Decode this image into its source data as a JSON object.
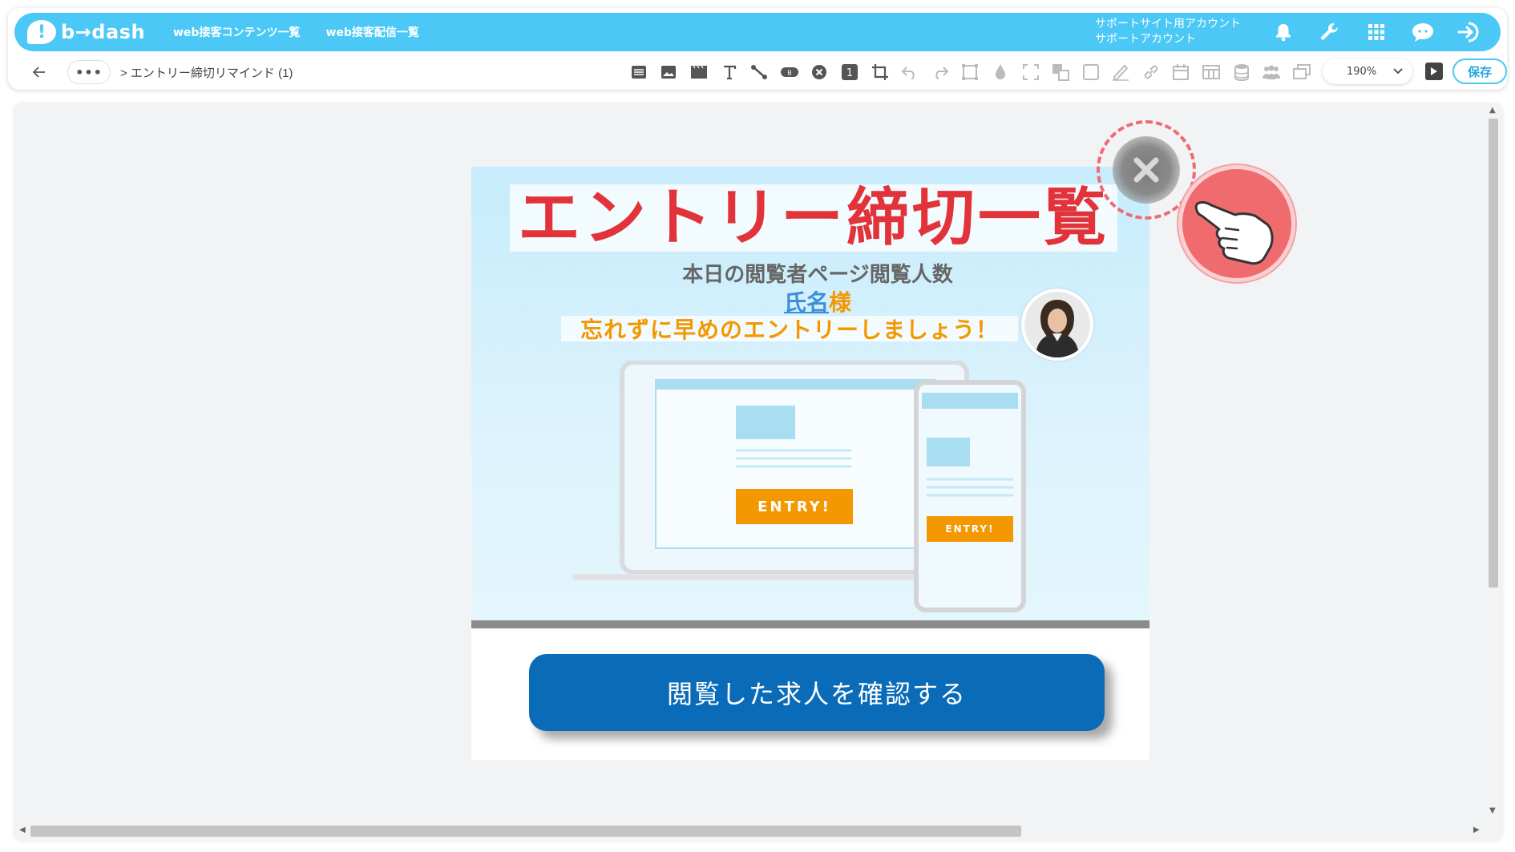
{
  "header": {
    "logo_text": "b→dash",
    "nav": [
      "web接客コンテンツ一覧",
      "web接客配信一覧"
    ],
    "account_line1": "サポートサイト用アカウント",
    "account_line2": "サポートアカウント",
    "icons": [
      "bell-icon",
      "wrench-icon",
      "grid-icon",
      "chat-bot-icon",
      "logout-icon"
    ],
    "bg_color": "#4bc8f5"
  },
  "toolbar": {
    "more_label": "•••",
    "breadcrumb": "> エントリー締切リマインド (1)",
    "zoom_value": "190%",
    "save_label": "保存",
    "tool_icons": [
      "list-icon",
      "image-icon",
      "video-icon",
      "text-icon",
      "connector-icon",
      "badge-icon",
      "close-element-icon",
      "number-icon",
      "crop-icon",
      "undo-icon",
      "redo-icon",
      "frame-icon",
      "drop-icon",
      "expand-icon",
      "layers-icon",
      "square-icon",
      "pen-icon",
      "link-icon",
      "calendar-icon",
      "table-icon",
      "database-icon",
      "users-icon",
      "copy-icon"
    ]
  },
  "banner": {
    "headline": "エントリー締切一覧",
    "subtitle": "本日の閲覧者ページ閲覧人数",
    "name_placeholder": "氏名",
    "name_suffix": "様",
    "reminder": "忘れずに早めのエントリーしましょう！",
    "entry_label": "ENTRY!",
    "cta_label": "閲覧した求人を確認する",
    "headline_color": "#e2333b",
    "accent_color": "#f39800",
    "cta_color": "#0a6bb8"
  }
}
